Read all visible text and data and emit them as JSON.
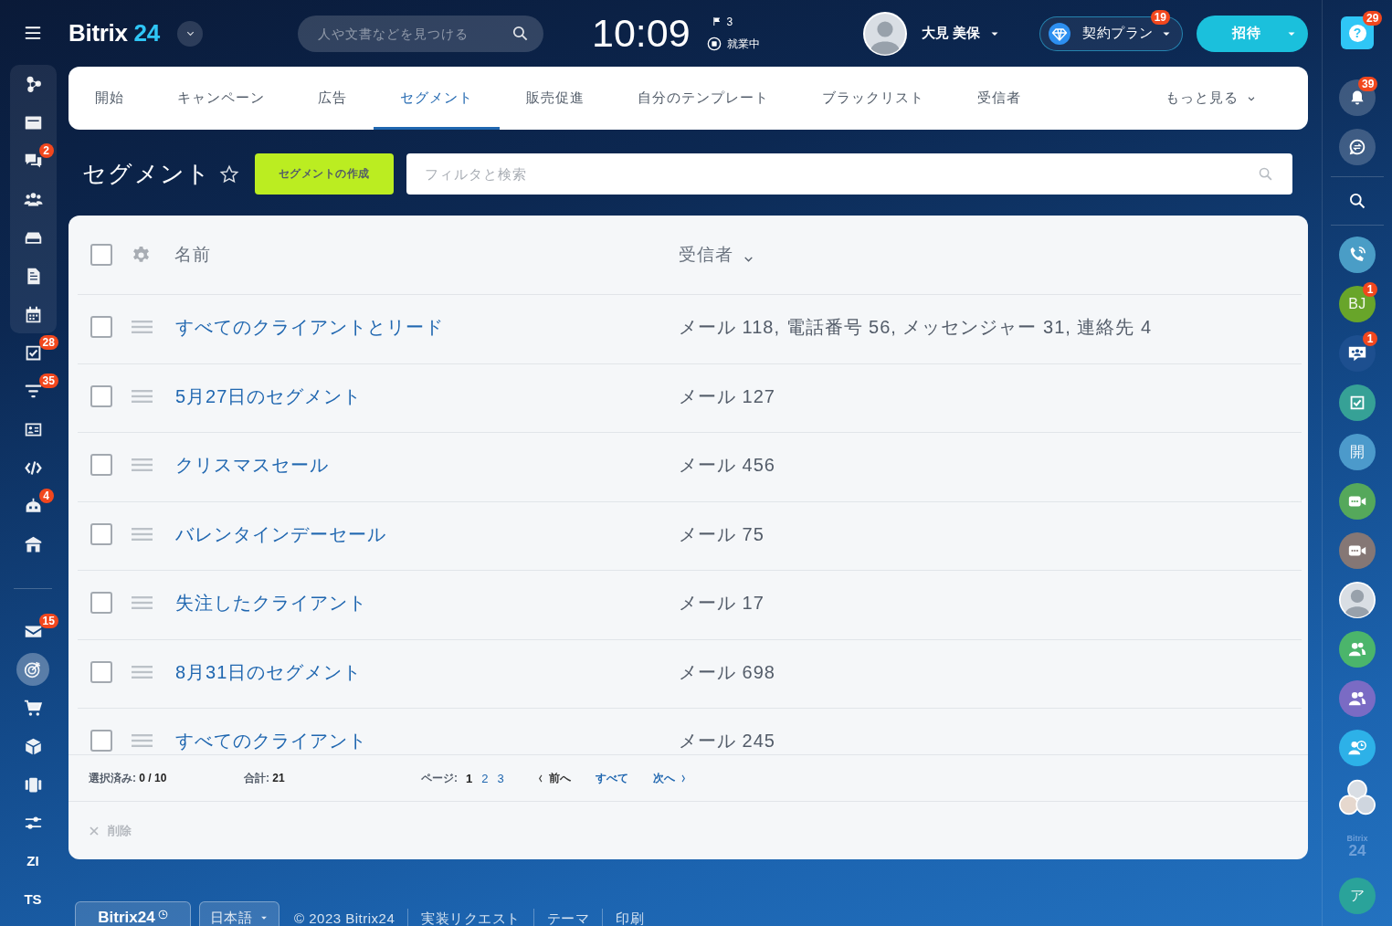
{
  "top_bar": {
    "logo": {
      "name": "Bitrix",
      "number": "24"
    },
    "search": {
      "placeholder": "人や文書などを見つける"
    },
    "clock": "10:09",
    "flag_count": "3",
    "work_status": "就業中",
    "user": {
      "name": "大見 美保"
    },
    "plan": {
      "label": "契約プラン",
      "badge": "19"
    },
    "invite": {
      "label": "招待"
    }
  },
  "left_sidebar": {
    "panel_items": [
      {
        "kind": "icon",
        "selected": false
      },
      {
        "kind": "icon",
        "selected": false
      },
      {
        "kind": "icon",
        "selected": false,
        "badge": "2"
      },
      {
        "kind": "icon",
        "selected": false
      },
      {
        "kind": "icon",
        "selected": false
      },
      {
        "kind": "icon",
        "selected": false
      },
      {
        "kind": "icon",
        "selected": false
      }
    ],
    "items": [
      {
        "kind": "icon",
        "selected": false,
        "badge": "28"
      },
      {
        "kind": "icon",
        "selected": false,
        "badge": "35"
      },
      {
        "kind": "icon",
        "selected": false
      },
      {
        "kind": "icon",
        "selected": false
      },
      {
        "kind": "icon",
        "selected": false,
        "badge": "4"
      },
      {
        "kind": "icon",
        "selected": false
      }
    ],
    "lower_items": [
      {
        "kind": "icon",
        "selected": false,
        "badge": "15"
      },
      {
        "kind": "icon",
        "selected": true
      },
      {
        "kind": "icon",
        "selected": false
      },
      {
        "kind": "icon",
        "selected": false
      },
      {
        "kind": "icon",
        "selected": false
      },
      {
        "kind": "icon",
        "selected": false
      },
      {
        "kind": "text",
        "label": "ZI",
        "selected": false
      },
      {
        "kind": "text",
        "label": "TS",
        "selected": false
      }
    ]
  },
  "tabs": {
    "items": [
      {
        "label": "開始",
        "selected": false
      },
      {
        "label": "キャンペーン",
        "selected": false
      },
      {
        "label": "広告",
        "selected": false
      },
      {
        "label": "セグメント",
        "selected": true
      },
      {
        "label": "販売促進",
        "selected": false
      },
      {
        "label": "自分のテンプレート",
        "selected": false
      },
      {
        "label": "ブラックリスト",
        "selected": false
      },
      {
        "label": "受信者",
        "selected": false
      }
    ],
    "more": {
      "label": "もっと見る"
    }
  },
  "page": {
    "title": "セグメント",
    "favorite": false,
    "create_button": "セグメントの作成",
    "filter": {
      "placeholder": "フィルタと検索"
    }
  },
  "table": {
    "select_all": {
      "checked": false
    },
    "columns": [
      {
        "label": "名前",
        "sorted": false
      },
      {
        "label": "受信者",
        "sorted": true
      }
    ],
    "rows": [
      {
        "name": "すべてのクライアントとリード",
        "recipients": "メール 118, 電話番号 56, メッセンジャー 31, 連絡先 4",
        "checked": false
      },
      {
        "name": "5月27日のセグメント",
        "recipients": "メール 127",
        "checked": false
      },
      {
        "name": "クリスマスセール",
        "recipients": "メール 456",
        "checked": false
      },
      {
        "name": "バレンタインデーセール",
        "recipients": "メール 75",
        "checked": false
      },
      {
        "name": "失注したクライアント",
        "recipients": "メール 17",
        "checked": false
      },
      {
        "name": "8月31日のセグメント",
        "recipients": "メール 698",
        "checked": false
      },
      {
        "name": "すべてのクライアント",
        "recipients": "メール 245",
        "checked": false
      }
    ],
    "footer": {
      "selected": {
        "label": "選択済み:",
        "value": "0 / 10"
      },
      "total": {
        "label": "合計:",
        "value": "21"
      },
      "pagination": {
        "label": "ページ:",
        "pages": [
          {
            "label": "1",
            "selected": true
          },
          {
            "label": "2",
            "selected": false
          },
          {
            "label": "3",
            "selected": false
          }
        ],
        "prev": {
          "label": "前へ",
          "disabled": true
        },
        "all": {
          "label": "すべて"
        },
        "next": {
          "label": "次へ",
          "disabled": false
        }
      }
    },
    "actions": [
      {
        "label": "削除",
        "disabled": true
      }
    ]
  },
  "footer": {
    "brand": "Bitrix24",
    "language": "日本語",
    "items": [
      "© 2023 Bitrix24",
      "実装リクエスト",
      "テーマ",
      "印刷"
    ]
  },
  "right_sidebar": {
    "help": {
      "symbol": "?",
      "badge": "29"
    },
    "notifications": {
      "badge": "39"
    },
    "items": [
      {
        "kind": "icon",
        "color": "#4a9dc6"
      },
      {
        "kind": "text",
        "label": "BJ",
        "color": "#68a52a",
        "badge": "1"
      },
      {
        "kind": "icon",
        "color": "#1d4f8f",
        "badge": "1"
      },
      {
        "kind": "icon",
        "color": "#36a196"
      },
      {
        "kind": "text",
        "label": "開",
        "color": "#4c9acb"
      },
      {
        "kind": "icon",
        "color": "#55a85b"
      },
      {
        "kind": "icon",
        "color": "#857775"
      },
      {
        "kind": "photo"
      },
      {
        "kind": "icon",
        "color": "#4bb56b"
      },
      {
        "kind": "icon",
        "color": "#7a6bc4"
      },
      {
        "kind": "icon",
        "color": "#2db1e8"
      },
      {
        "kind": "group_photo"
      },
      {
        "kind": "logo",
        "name": "Bitrix",
        "number": "24"
      },
      {
        "kind": "text",
        "label": "ア",
        "color": "#2aa39a"
      }
    ]
  }
}
